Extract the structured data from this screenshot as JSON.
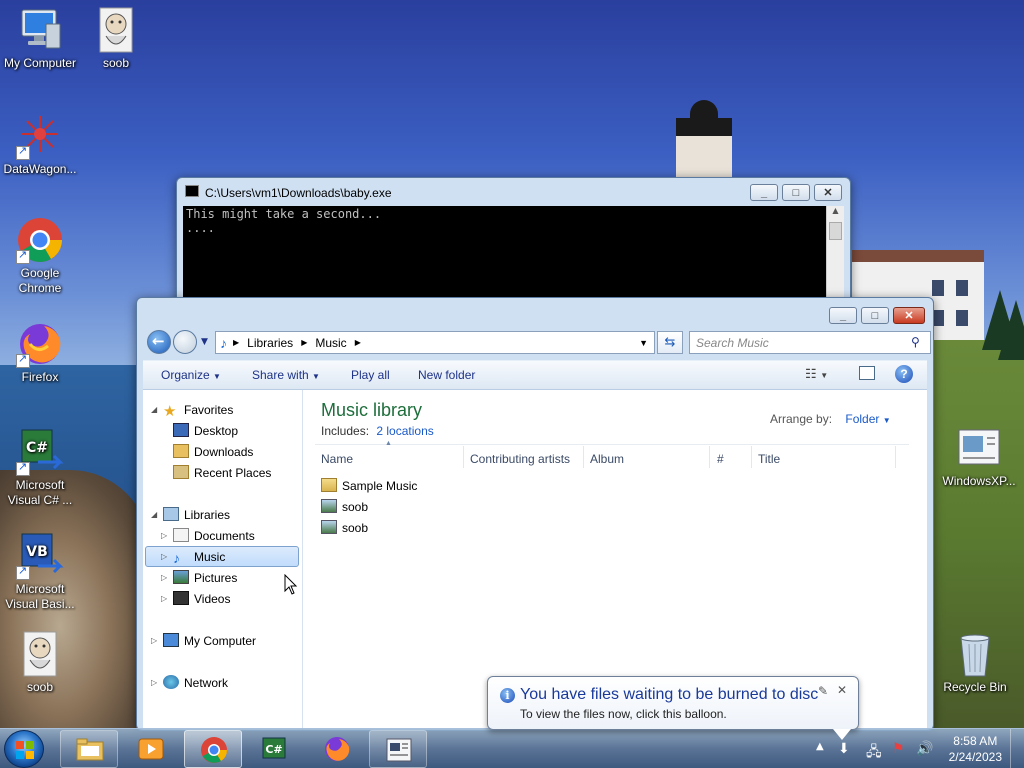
{
  "desktop": {
    "icons": [
      {
        "label": "My Computer"
      },
      {
        "label": "soob"
      },
      {
        "label": "DataWagon..."
      },
      {
        "label": "Google Chrome"
      },
      {
        "label": "Firefox"
      },
      {
        "label": "Microsoft Visual C# ..."
      },
      {
        "label": "Microsoft Visual Basi..."
      },
      {
        "label": "soob"
      },
      {
        "label": "WindowsXP..."
      },
      {
        "label": "Recycle Bin"
      }
    ]
  },
  "console": {
    "title": "C:\\Users\\vm1\\Downloads\\baby.exe",
    "output": "This might take a second...\n...."
  },
  "explorer": {
    "breadcrumb": [
      "Libraries",
      "Music"
    ],
    "search_placeholder": "Search Music",
    "commands": {
      "organize": "Organize",
      "share_with": "Share with",
      "play_all": "Play all",
      "new_folder": "New folder"
    },
    "nav": {
      "favorites": "Favorites",
      "desktop": "Desktop",
      "downloads": "Downloads",
      "recent_places": "Recent Places",
      "libraries": "Libraries",
      "documents": "Documents",
      "music": "Music",
      "pictures": "Pictures",
      "videos": "Videos",
      "my_computer": "My Computer",
      "network": "Network"
    },
    "library": {
      "title": "Music library",
      "includes_label": "Includes:",
      "includes_link": "2 locations",
      "arrange_label": "Arrange by:",
      "arrange_value": "Folder"
    },
    "columns": [
      "Name",
      "Contributing artists",
      "Album",
      "#",
      "Title"
    ],
    "files": [
      {
        "name": "Sample Music",
        "type": "folder"
      },
      {
        "name": "soob",
        "type": "image"
      },
      {
        "name": "soob",
        "type": "image"
      }
    ]
  },
  "balloon": {
    "title": "You have files waiting to be burned to disc",
    "text": "To view the files now, click this balloon."
  },
  "taskbar": {
    "time": "8:58 AM",
    "date": "2/24/2023"
  },
  "colors": {
    "accent": "#1e3287",
    "library_title": "#1e6e3c",
    "link": "#1a5ac8"
  }
}
